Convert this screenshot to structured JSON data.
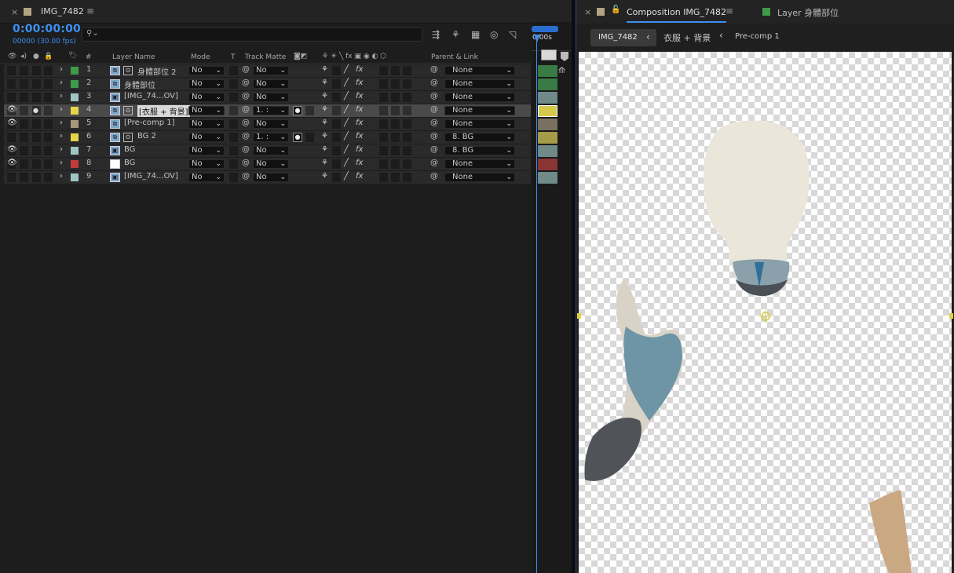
{
  "timeline": {
    "tab_title": "IMG_7482",
    "timecode": "0:00:00:00",
    "frame_info": "00000 (30.00 fps)",
    "search_placeholder": "",
    "ruler_label": "0:00s",
    "headers": {
      "num": "#",
      "layer_name": "Layer Name",
      "mode": "Mode",
      "t": "T",
      "track_matte": "Track Matte",
      "parent": "Parent & Link"
    },
    "layers": [
      {
        "num": "1",
        "name": "身體部位 2",
        "mode": "No",
        "matte": "No",
        "parent": "None",
        "color": "#3f9a4a",
        "bar": "#3a7a44",
        "type": "precomp",
        "fx_icon": true,
        "eye": false,
        "selected": false
      },
      {
        "num": "2",
        "name": "身體部位",
        "mode": "No",
        "matte": "No",
        "parent": "None",
        "color": "#3f9a4a",
        "bar": "#3a7a44",
        "type": "precomp",
        "fx_icon": false,
        "eye": false,
        "selected": false
      },
      {
        "num": "3",
        "name": "[IMG_74...OV]",
        "mode": "No",
        "matte": "No",
        "parent": "None",
        "color": "#9bc7c3",
        "bar": "#6f8a88",
        "type": "footage",
        "fx_icon": false,
        "eye": false,
        "selected": false
      },
      {
        "num": "4",
        "name": "[衣服 + 背景]",
        "mode": "No",
        "matte": "1. :",
        "parent": "None",
        "color": "#e3d54a",
        "bar": "#d6c84a",
        "type": "precomp",
        "fx_icon": true,
        "eye": true,
        "selected": true
      },
      {
        "num": "5",
        "name": "[Pre-comp 1]",
        "mode": "No",
        "matte": "No",
        "parent": "None",
        "color": "#a8977a",
        "bar": "#7a7060",
        "type": "precomp",
        "fx_icon": false,
        "eye": true,
        "selected": false
      },
      {
        "num": "6",
        "name": "BG 2",
        "mode": "No",
        "matte": "1. :",
        "parent": "8. BG",
        "color": "#e3d54a",
        "bar": "#a69b48",
        "type": "precomp",
        "fx_icon": true,
        "eye": false,
        "selected": false
      },
      {
        "num": "7",
        "name": "BG",
        "mode": "No",
        "matte": "No",
        "parent": "8. BG",
        "color": "#9bc7c3",
        "bar": "#6f8a88",
        "type": "footage",
        "fx_icon": false,
        "eye": true,
        "selected": false
      },
      {
        "num": "8",
        "name": "BG",
        "mode": "No",
        "matte": "No",
        "parent": "None",
        "color": "#c23a3a",
        "bar": "#8a3434",
        "type": "solid",
        "fx_icon": false,
        "eye": true,
        "selected": false
      },
      {
        "num": "9",
        "name": "[IMG_74...OV]",
        "mode": "No",
        "matte": "No",
        "parent": "None",
        "color": "#9bc7c3",
        "bar": "#6f8a88",
        "type": "footage",
        "fx_icon": false,
        "eye": false,
        "selected": false
      }
    ]
  },
  "composition": {
    "tab_title": "Composition IMG_7482",
    "layer_tab": "Layer 身體部位",
    "breadcrumbs": [
      "IMG_7482",
      "衣服 + 背景",
      "Pre-comp 1"
    ]
  },
  "colors": {
    "accent": "#3d8fef",
    "layer_tab_swatch": "#3f9a4a",
    "comp_swatch": "#b5a484"
  }
}
